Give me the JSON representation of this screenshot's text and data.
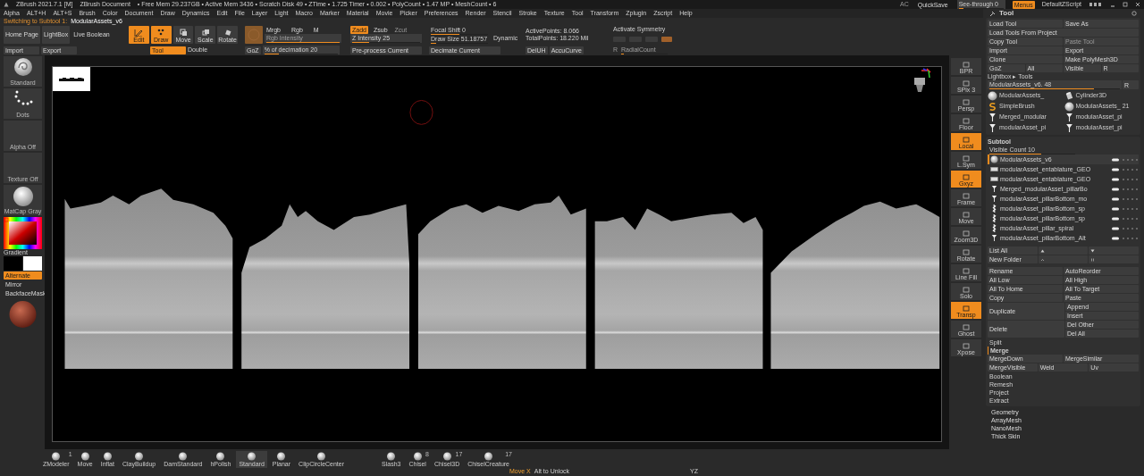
{
  "title_bar": {
    "app": "ZBrush 2021.7.1 [M]",
    "document": "ZBrush Document",
    "stats": "• Free Mem 29.237GB • Active Mem 3436 • Scratch Disk 49 • ZTime • 1.725 Timer • 0.002 • PolyCount • 1.47 MP • MeshCount • 6",
    "ac": "AC",
    "quicksave": "QuickSave",
    "see_through": {
      "label": "See-through  0",
      "level": 0.1
    },
    "menus": {
      "label": "Menus",
      "on": true
    },
    "script": "DefaultZScript"
  },
  "menu_bar": [
    "Alpha",
    "ALT+H",
    "ALT+S",
    "Brush",
    "Color",
    "Document",
    "Draw",
    "Dynamics",
    "Edit",
    "File",
    "Layer",
    "Light",
    "Macro",
    "Marker",
    "Material",
    "Movie",
    "Picker",
    "Preferences",
    "Render",
    "Stencil",
    "Stroke",
    "Texture",
    "Tool",
    "Transform",
    "Zplugin",
    "Zscript",
    "Help"
  ],
  "notice": {
    "label": "Switching to Subtool 1:",
    "value": "ModularAssets_v6"
  },
  "shelf": {
    "home": [
      "Home Page",
      "LightBox",
      "Live Boolean"
    ],
    "file": [
      "Import",
      "Export"
    ],
    "modes": [
      {
        "label": "Edit",
        "on": true
      },
      {
        "label": "Draw",
        "on": true
      },
      {
        "label": "Move",
        "on": false
      },
      {
        "label": "Scale",
        "on": false
      },
      {
        "label": "Rotate",
        "on": false
      }
    ],
    "tool": {
      "label": "Tool",
      "on": true
    },
    "double": "Double",
    "goz": "GoZ",
    "color_modes": [
      {
        "label": "Mrgb",
        "on": false
      },
      {
        "label": "Rgb",
        "on": false
      },
      {
        "label": "M",
        "on": false
      }
    ],
    "rgb_intensity": {
      "label": "Rgb Intensity",
      "level": 1.0
    },
    "z_modes": [
      {
        "label": "Zadd",
        "on": true,
        "disabled": false
      },
      {
        "label": "Zsub",
        "on": false,
        "disabled": false
      },
      {
        "label": "Zcut",
        "on": false,
        "disabled": true
      }
    ],
    "z_intensity": {
      "label": "Z Intensity 25",
      "level": 0.25
    },
    "focal_shift": {
      "label": "Focal Shift 0",
      "level": 0.5
    },
    "draw_size": {
      "label": "Draw Size 51.18757",
      "level": 0.1
    },
    "dynamic": "Dynamic",
    "decimation": {
      "label": "% of decimation 20",
      "level": 0.2
    },
    "preprocess": "Pre-process Current",
    "decimate": "Decimate Current",
    "points": [
      "ActivePoints: 8.066",
      "TotalPoints: 18.220 Mil"
    ],
    "deluh": "DelUH",
    "accucurve": "AccuCurve",
    "symmetry": "Activate Symmetry",
    "axes": [
      {
        "on": false
      },
      {
        "on": false
      },
      {
        "on": false
      }
    ],
    "symmetry_toggle": {
      "on": true
    },
    "r": "R",
    "radial": {
      "label": "RadialCount",
      "level": 0.05
    }
  },
  "left_shelf": {
    "items": [
      {
        "label": "Standard",
        "kind": "brush"
      },
      {
        "label": "Dots",
        "kind": "stroke"
      },
      {
        "label": "Alpha Off",
        "kind": "empty"
      },
      {
        "label": "Texture Off",
        "kind": "empty"
      },
      {
        "label": "MatCap Gray",
        "kind": "material"
      }
    ],
    "gradient": "Gradient",
    "toggles": [
      {
        "label": "Alternate",
        "on": true
      },
      {
        "label": "Mirror",
        "on": false
      },
      {
        "label": "BackfaceMask",
        "on": false
      }
    ]
  },
  "right_shelf": [
    {
      "label": "BPR",
      "on": false
    },
    {
      "label": "SPix 3",
      "on": false
    },
    {
      "label": "Persp",
      "on": false
    },
    {
      "label": "Floor",
      "on": false
    },
    {
      "label": "Local",
      "on": true
    },
    {
      "label": "L.Sym",
      "on": false
    },
    {
      "label": "Gxyz",
      "on": true
    },
    {
      "label": "Frame",
      "on": false
    },
    {
      "label": "Move",
      "on": false
    },
    {
      "label": "Zoom3D",
      "on": false
    },
    {
      "label": "Rotate",
      "on": false
    },
    {
      "label": "Line Fill",
      "on": false
    },
    {
      "label": "Solo",
      "on": false
    },
    {
      "label": "Transp",
      "on": true
    },
    {
      "label": "Ghost",
      "on": false
    },
    {
      "label": "Xpose",
      "on": false
    }
  ],
  "tool_panel": {
    "title": "Tool",
    "rows": [
      [
        "Load Tool",
        "Save As"
      ],
      [
        "Load Tools From Project"
      ],
      [
        "Copy Tool",
        "Paste Tool"
      ],
      [
        "Import",
        "Export"
      ],
      [
        "Clone",
        "Make PolyMesh3D"
      ],
      [
        "GoZ",
        "All",
        "Visible",
        "R"
      ]
    ],
    "lightbox": "Lightbox ▸ Tools",
    "current": {
      "label": "ModularAssets_v6. 48",
      "level": 0.8,
      "r": "R"
    },
    "thumbnails": [
      {
        "label": "ModularAssets_",
        "kind": "sphere"
      },
      {
        "label": "Cylinder3D",
        "kind": "cylinder"
      },
      {
        "label": "SimpleBrush",
        "kind": "brush"
      },
      {
        "label": "ModularAssets_",
        "kind": "sphere",
        "count": "21"
      },
      {
        "label": "Merged_modular",
        "kind": "pillar"
      },
      {
        "label": "modularAsset_pi",
        "kind": "pillar"
      },
      {
        "label": "modularAsset_pi",
        "kind": "pillar"
      },
      {
        "label": "modularAsset_pi",
        "kind": "pillar"
      }
    ]
  },
  "subtool": {
    "title": "Subtool",
    "visible_count": {
      "label": "Visible Count 10",
      "level": 0.6
    },
    "items": [
      {
        "name": "ModularAssets_v6",
        "kind": "sphere",
        "selected": true
      },
      {
        "name": "modularAsset_entablature_GEO",
        "kind": "slab",
        "selected": false
      },
      {
        "name": "modularAsset_entablature_GEO",
        "kind": "slab",
        "selected": false
      },
      {
        "name": "Merged_modularAsset_pillarBo",
        "kind": "pillar",
        "selected": false
      },
      {
        "name": "modularAsset_pillarBottom_mo",
        "kind": "pillar",
        "selected": false
      },
      {
        "name": "modularAsset_pillarBottom_sp",
        "kind": "spiral",
        "selected": false
      },
      {
        "name": "modularAsset_pillarBottom_sp",
        "kind": "spiral",
        "selected": false
      },
      {
        "name": "modularAsset_pillar_spiral",
        "kind": "spiral",
        "selected": false
      },
      {
        "name": "modularAsset_pillarBottom_Alt",
        "kind": "pillar",
        "selected": false
      }
    ],
    "list_all": "List All",
    "new_folder": "New Folder",
    "actions": [
      {
        "kind": "row",
        "labels": [
          "Rename",
          "AutoReorder"
        ]
      },
      {
        "kind": "row",
        "labels": [
          "All Low",
          "All High"
        ]
      },
      {
        "kind": "row",
        "labels": [
          "All To Home",
          "All To Target"
        ]
      },
      {
        "kind": "row",
        "labels": [
          "Copy",
          "Paste"
        ]
      },
      {
        "kind": "split",
        "labels": [
          "Duplicate",
          "Append",
          "Insert"
        ]
      },
      {
        "kind": "split",
        "labels": [
          "Delete",
          "Del Other",
          "Del All"
        ]
      },
      {
        "kind": "item",
        "labels": [
          "Split"
        ]
      },
      {
        "kind": "header",
        "labels": [
          "Merge"
        ]
      },
      {
        "kind": "row",
        "labels": [
          "MergeDown",
          "MergeSimilar"
        ]
      },
      {
        "kind": "row",
        "labels": [
          "MergeVisible",
          "Weld",
          "Uv"
        ]
      },
      {
        "kind": "item",
        "labels": [
          "Boolean"
        ]
      },
      {
        "kind": "item",
        "labels": [
          "Remesh"
        ]
      },
      {
        "kind": "item",
        "labels": [
          "Project"
        ]
      },
      {
        "kind": "item",
        "labels": [
          "Extract"
        ]
      }
    ]
  },
  "tool_sections": [
    "Geometry",
    "ArrayMesh",
    "NanoMesh",
    "Thick Skin"
  ],
  "brush_shelf": [
    {
      "label": "ZModeler",
      "count": "1",
      "selected": false
    },
    {
      "label": "Move",
      "selected": false
    },
    {
      "label": "Inflat",
      "selected": false
    },
    {
      "label": "ClayBuildup",
      "selected": false
    },
    {
      "label": "DamStandard",
      "selected": false
    },
    {
      "label": "hPolish",
      "selected": false
    },
    {
      "label": "Standard",
      "selected": true
    },
    {
      "label": "Planar",
      "selected": false
    },
    {
      "label": "ClipCircleCenter",
      "selected": false
    },
    {
      "label": "Slash3",
      "selected": false
    },
    {
      "label": "Chisel",
      "count": "8",
      "selected": false
    },
    {
      "label": "Chisel3D",
      "count": "17",
      "selected": false
    },
    {
      "label": "ChiselCreature",
      "count": "17",
      "selected": false
    }
  ],
  "status": {
    "action": "Move X",
    "hint": "Alt to Unlock",
    "axis": "YZ"
  }
}
